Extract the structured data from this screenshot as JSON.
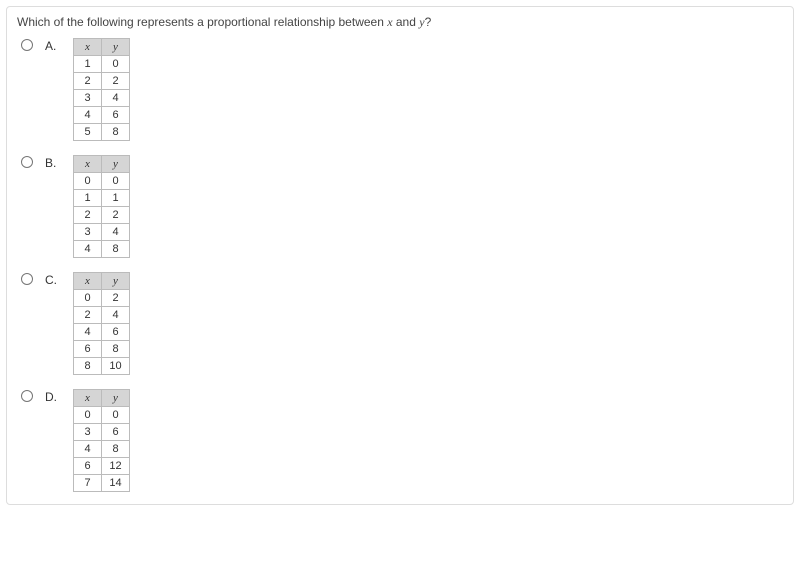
{
  "question": {
    "prefix": "Which of the following represents a proportional relationship between ",
    "var1": "x",
    "mid": " and ",
    "var2": "y",
    "suffix": "?"
  },
  "headers": {
    "x": "x",
    "y": "y"
  },
  "options": [
    {
      "label": "A.",
      "rows": [
        {
          "x": "1",
          "y": "0"
        },
        {
          "x": "2",
          "y": "2"
        },
        {
          "x": "3",
          "y": "4"
        },
        {
          "x": "4",
          "y": "6"
        },
        {
          "x": "5",
          "y": "8"
        }
      ]
    },
    {
      "label": "B.",
      "rows": [
        {
          "x": "0",
          "y": "0"
        },
        {
          "x": "1",
          "y": "1"
        },
        {
          "x": "2",
          "y": "2"
        },
        {
          "x": "3",
          "y": "4"
        },
        {
          "x": "4",
          "y": "8"
        }
      ]
    },
    {
      "label": "C.",
      "rows": [
        {
          "x": "0",
          "y": "2"
        },
        {
          "x": "2",
          "y": "4"
        },
        {
          "x": "4",
          "y": "6"
        },
        {
          "x": "6",
          "y": "8"
        },
        {
          "x": "8",
          "y": "10"
        }
      ]
    },
    {
      "label": "D.",
      "rows": [
        {
          "x": "0",
          "y": "0"
        },
        {
          "x": "3",
          "y": "6"
        },
        {
          "x": "4",
          "y": "8"
        },
        {
          "x": "6",
          "y": "12"
        },
        {
          "x": "7",
          "y": "14"
        }
      ]
    }
  ]
}
